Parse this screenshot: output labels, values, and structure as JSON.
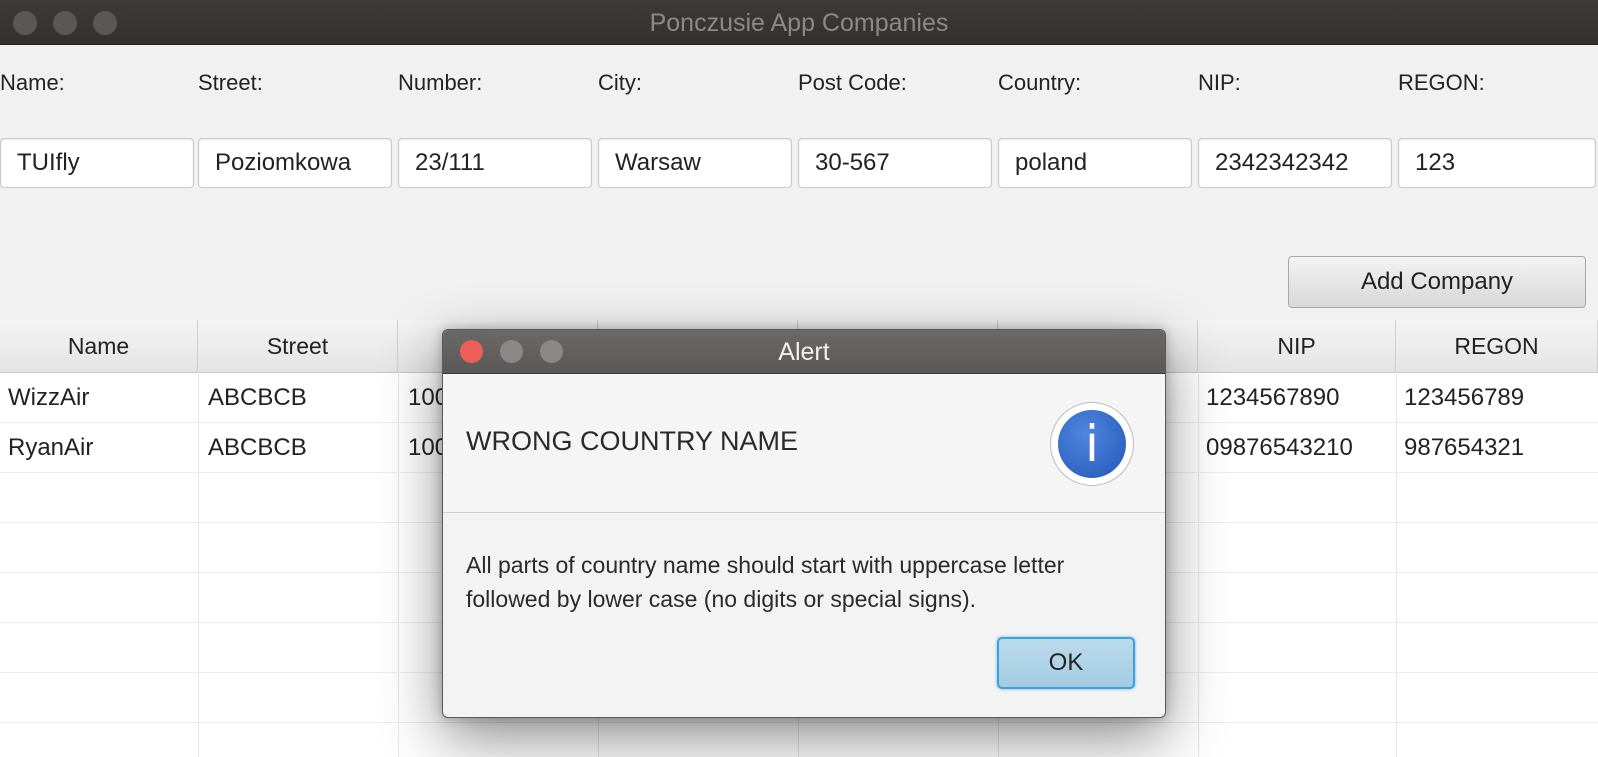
{
  "window": {
    "title": "Ponczusie App Companies"
  },
  "form": {
    "labels": [
      "Name:",
      "Street:",
      "Number:",
      "City:",
      "Post Code:",
      "Country:",
      "NIP:",
      "REGON:"
    ],
    "values": [
      "TUIfly",
      "Poziomkowa",
      "23/111",
      "Warsaw",
      "30-567",
      "poland",
      "2342342342",
      "123"
    ]
  },
  "add_button": "Add Company",
  "table": {
    "headers": [
      "Name",
      "Street",
      "",
      "",
      "",
      "",
      "NIP",
      "REGON"
    ],
    "rows": [
      {
        "name": "WizzAir",
        "street": "ABCBCB",
        "number": "100",
        "nip": "1234567890",
        "regon": "123456789"
      },
      {
        "name": "RyanAir",
        "street": "ABCBCB",
        "number": "100",
        "nip": "09876543210",
        "regon": "987654321"
      }
    ]
  },
  "alert": {
    "title": "Alert",
    "header": "WRONG COUNTRY NAME",
    "content": "All parts of country name should start with uppercase letter followed by lower case (no digits or special signs).",
    "ok": "OK",
    "icon": "info-icon",
    "icon_glyph": "i",
    "colors": {
      "close": "#ec5f56",
      "inactive": "#8a8886",
      "icon_blue": "#2f66c7",
      "ok_focus": "#3aa0e0"
    }
  }
}
